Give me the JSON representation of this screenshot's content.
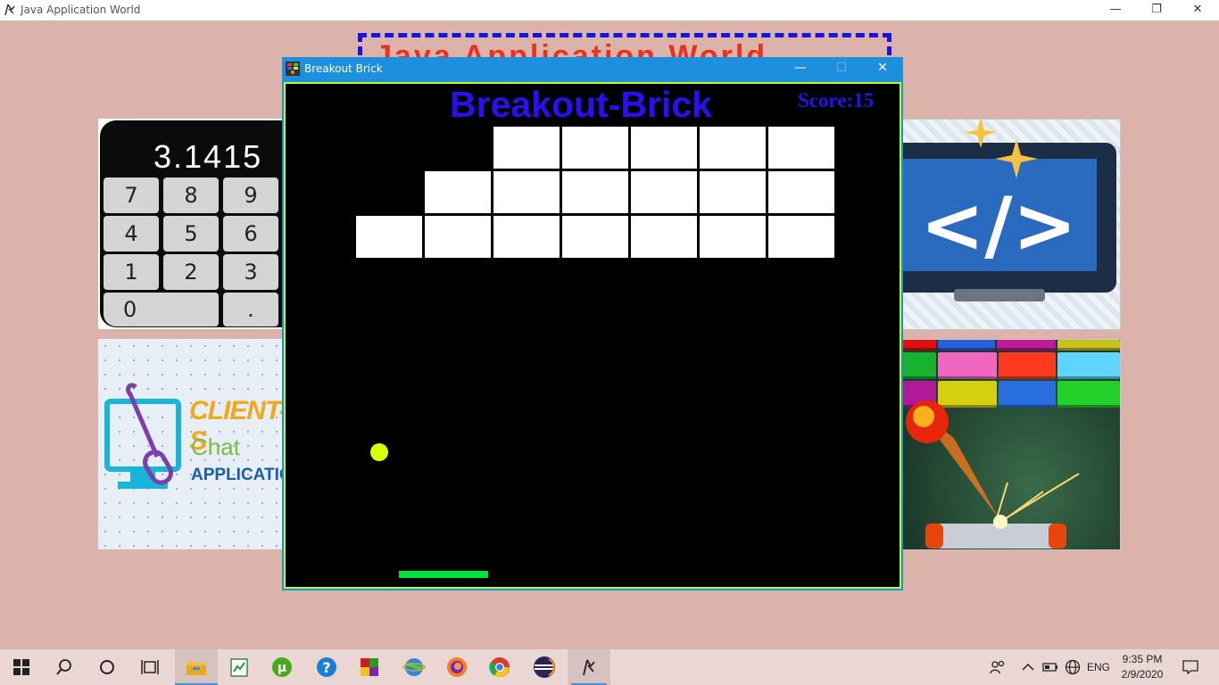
{
  "main_window": {
    "title": "Java Application World",
    "controls": {
      "minimize": "—",
      "restore": "❐",
      "close": "✕"
    }
  },
  "background_heading": "Java Application World",
  "tiles": {
    "calculator": {
      "display": "3.1415",
      "keys": [
        "7",
        "8",
        "9",
        "4",
        "5",
        "6",
        "1",
        "2",
        "3",
        "0",
        "."
      ]
    },
    "client_chat": {
      "line1": "CLIENT-S",
      "line2": "Chat",
      "line3": "APPLICATION"
    },
    "code_icon": {
      "symbol": "</>"
    },
    "breakout_art": {
      "icon": "breakout-game-art"
    }
  },
  "game_window": {
    "title": "Breakout Brick",
    "controls": {
      "minimize": "—",
      "maximize": "☐",
      "close": "✕"
    },
    "heading": "Breakout-Brick",
    "score": "Score:15",
    "bricks_per_row": [
      5,
      6,
      7
    ],
    "brick_color": "#ffffff",
    "ball_color": "#d9ff00",
    "paddle_color": "#00e03a"
  },
  "taskbar": {
    "items": [
      "start",
      "search",
      "cortana",
      "task-view",
      "file-explorer",
      "notepad",
      "utorrent",
      "help",
      "winrar",
      "network-app",
      "firefox",
      "chrome",
      "eclipse",
      "java-app"
    ],
    "language": "ENG",
    "time": "9:35 PM",
    "date": "2/9/2020"
  }
}
